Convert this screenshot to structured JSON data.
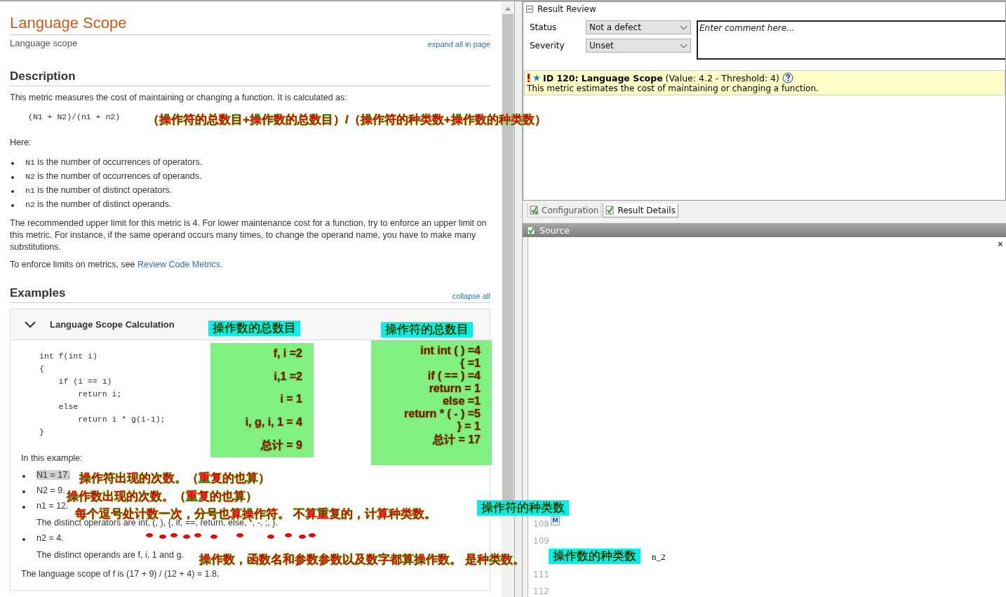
{
  "help": {
    "title": "Language Scope",
    "subtitle": "Language scope",
    "expand_link": "expand all in page",
    "description_heading": "Description",
    "intro": "This metric measures the cost of maintaining or changing a function. It is calculated as:",
    "formula": "(N1 + N2)/(n1 + n2)",
    "here": "Here:",
    "definitions": [
      {
        "code": "N1",
        "text": "is the number of occurrences of operators."
      },
      {
        "code": "N2",
        "text": "is the number of occurrences of operands."
      },
      {
        "code": "n1",
        "text": "is the number of distinct operators."
      },
      {
        "code": "n2",
        "text": "is the number of distinct operands."
      }
    ],
    "limit_paragraph": "The recommended upper limit for this metric is 4. For lower maintenance cost for a function, try to enforce an upper limit on this metric. For instance, if the same operand occurs many times, to change the operand name, you have to make many substitutions.",
    "enforce_text": "To enforce limits on metrics, see",
    "enforce_link": "Review Code Metrics.",
    "examples_heading": "Examples",
    "collapse_link": "collapse all",
    "example": {
      "title": "Language Scope Calculation",
      "expanded": true,
      "code": [
        "int f(int i)",
        "{",
        "    if (i == 1)",
        "        return i;",
        "    else",
        "        return i * g(i-1);",
        "}"
      ],
      "in_this_example": "In this example:",
      "items": [
        {
          "text": "N1 = 17.",
          "highlighted": true
        },
        {
          "text": "N2 = 9.",
          "highlighted": false
        },
        {
          "text": "n1 = 12.",
          "highlighted": false,
          "detail": "The distinct operators are int, (, ), {, if, ==, return, else, *, -, ;, }."
        },
        {
          "text": "n2 = 4.",
          "highlighted": false,
          "detail": "The distinct operands are f, i, 1 and g."
        }
      ],
      "conclusion": "The language scope of f is (17 + 9) / (12 + 4) = 1.8."
    }
  },
  "review": {
    "title": "Result Review",
    "expanded": true,
    "fields": [
      {
        "label": "Status",
        "value": "Not a defect"
      },
      {
        "label": "Severity",
        "value": "Unset"
      }
    ],
    "comment": {
      "placeholder": "Enter comment here..."
    },
    "message": {
      "title": "ID 120: Language Scope",
      "details": "(Value: 4.2 - Threshold: 4)",
      "description": "This metric estimates the cost of maintaining or changing a function."
    },
    "tabs": [
      {
        "label": "Configuration",
        "selected": false
      },
      {
        "label": "Result Details",
        "selected": true
      }
    ],
    "source": {
      "title": "Source",
      "close": "×",
      "lines": [
        {
          "number": "108",
          "marker": "M"
        },
        {
          "number": "109"
        },
        {
          "text": "n_2"
        },
        {
          "number": "111"
        },
        {
          "number": "112"
        }
      ]
    }
  },
  "annotations": [
    {
      "kind": "red",
      "text": "（操作符的总数目+操作数的总数目）/（操作符的种类数+操作数的种类数）"
    },
    {
      "kind": "cyan",
      "text": "操作数的总数目"
    },
    {
      "kind": "cyan",
      "text": "操作符的总数目"
    },
    {
      "kind": "green",
      "lines": [
        "f, i  =2",
        "i,1 =2",
        "i = 1",
        "i, g, i, 1  = 4",
        "总计 = 9"
      ]
    },
    {
      "kind": "green",
      "lines": [
        "int int ( )  =4",
        "{ =1",
        "if ( == ) =4",
        "return = 1",
        "else =1",
        "return * ( - ) =5",
        "} = 1",
        "总计 = 17"
      ]
    },
    {
      "kind": "red",
      "text": "操作符出现的次数。（重复的也算）"
    },
    {
      "kind": "red",
      "text": "操作数出现的次数。（重复的也算）"
    },
    {
      "kind": "red",
      "text": "每个逗号处计数一次，分号也算操作符。 不算重复的，计算种类数。"
    },
    {
      "kind": "cyan",
      "text": "操作符的种类数"
    },
    {
      "kind": "red",
      "text": "操作数，函数名和参数参数以及数字都算操作数。 是种类数。"
    },
    {
      "kind": "cyan",
      "text": "操作数的种类数"
    }
  ]
}
